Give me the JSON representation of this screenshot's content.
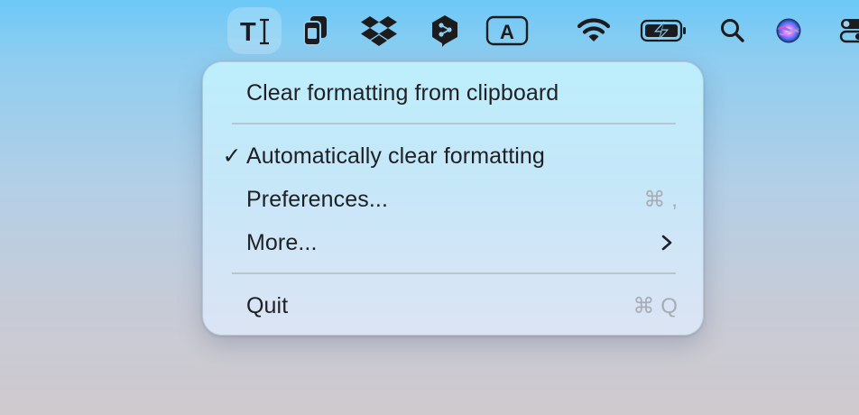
{
  "menubar": {
    "items": [
      {
        "icon": "text-cursor-icon",
        "active": true
      },
      {
        "icon": "clipboard-icon"
      },
      {
        "icon": "dropbox-icon"
      },
      {
        "icon": "deepl-icon"
      },
      {
        "icon": "input-source-icon",
        "label": "A"
      },
      {
        "icon": "wifi-icon"
      },
      {
        "icon": "battery-charging-icon"
      },
      {
        "icon": "search-icon"
      },
      {
        "icon": "siri-icon"
      },
      {
        "icon": "control-center-icon"
      }
    ],
    "text_cursor_label": "T",
    "input_source_label": "A"
  },
  "menu": {
    "clear_formatting": "Clear formatting from clipboard",
    "auto_clear": {
      "label": "Automatically clear formatting",
      "checked": true,
      "check_mark": "✓"
    },
    "preferences": {
      "label": "Preferences...",
      "shortcut": "⌘ ,"
    },
    "more": {
      "label": "More..."
    },
    "quit": {
      "label": "Quit",
      "shortcut": "⌘ Q"
    }
  },
  "colors": {
    "accent_blue": "#6cc9f7",
    "menu_text": "#1f2024",
    "shortcut_text": "#a7adb6"
  }
}
